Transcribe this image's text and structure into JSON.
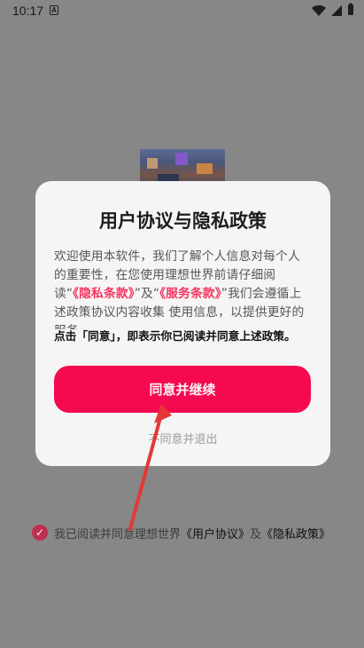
{
  "status_bar": {
    "time": "10:17",
    "app_icon_text": "A"
  },
  "dialog": {
    "title": "用户协议与隐私政策",
    "body_parts": {
      "p1": "欢迎使用本软件，我们了解个人信息对每个人的重要性，在您使用理想世界前请仔细阅读",
      "quote_left_1": "“",
      "privacy_link": "《隐私条款》",
      "quote_right_1": "”",
      "and": "及",
      "quote_left_2": "“",
      "service_link": "《服务条款》",
      "quote_right_2": "”",
      "p2": "我们会遵循上述政策协议内容收集 使用信息，以提供更好的服务。"
    },
    "notice": "点击「同意」，即表示你已阅读并同意上述政策。",
    "agree_button": "同意并继续",
    "disagree_link": "不同意并退出"
  },
  "agreement": {
    "prefix": "我已阅读并同意理想世界",
    "user_agreement": "《用户协议》",
    "and": "及",
    "privacy_policy": "《隐私政策》"
  },
  "colors": {
    "accent": "#ff0a54",
    "link": "#ff3a68",
    "checkbox": "#c63252"
  },
  "icons": {
    "wifi": "wifi-icon",
    "signal": "signal-icon",
    "battery": "battery-icon",
    "check": "check-icon"
  }
}
